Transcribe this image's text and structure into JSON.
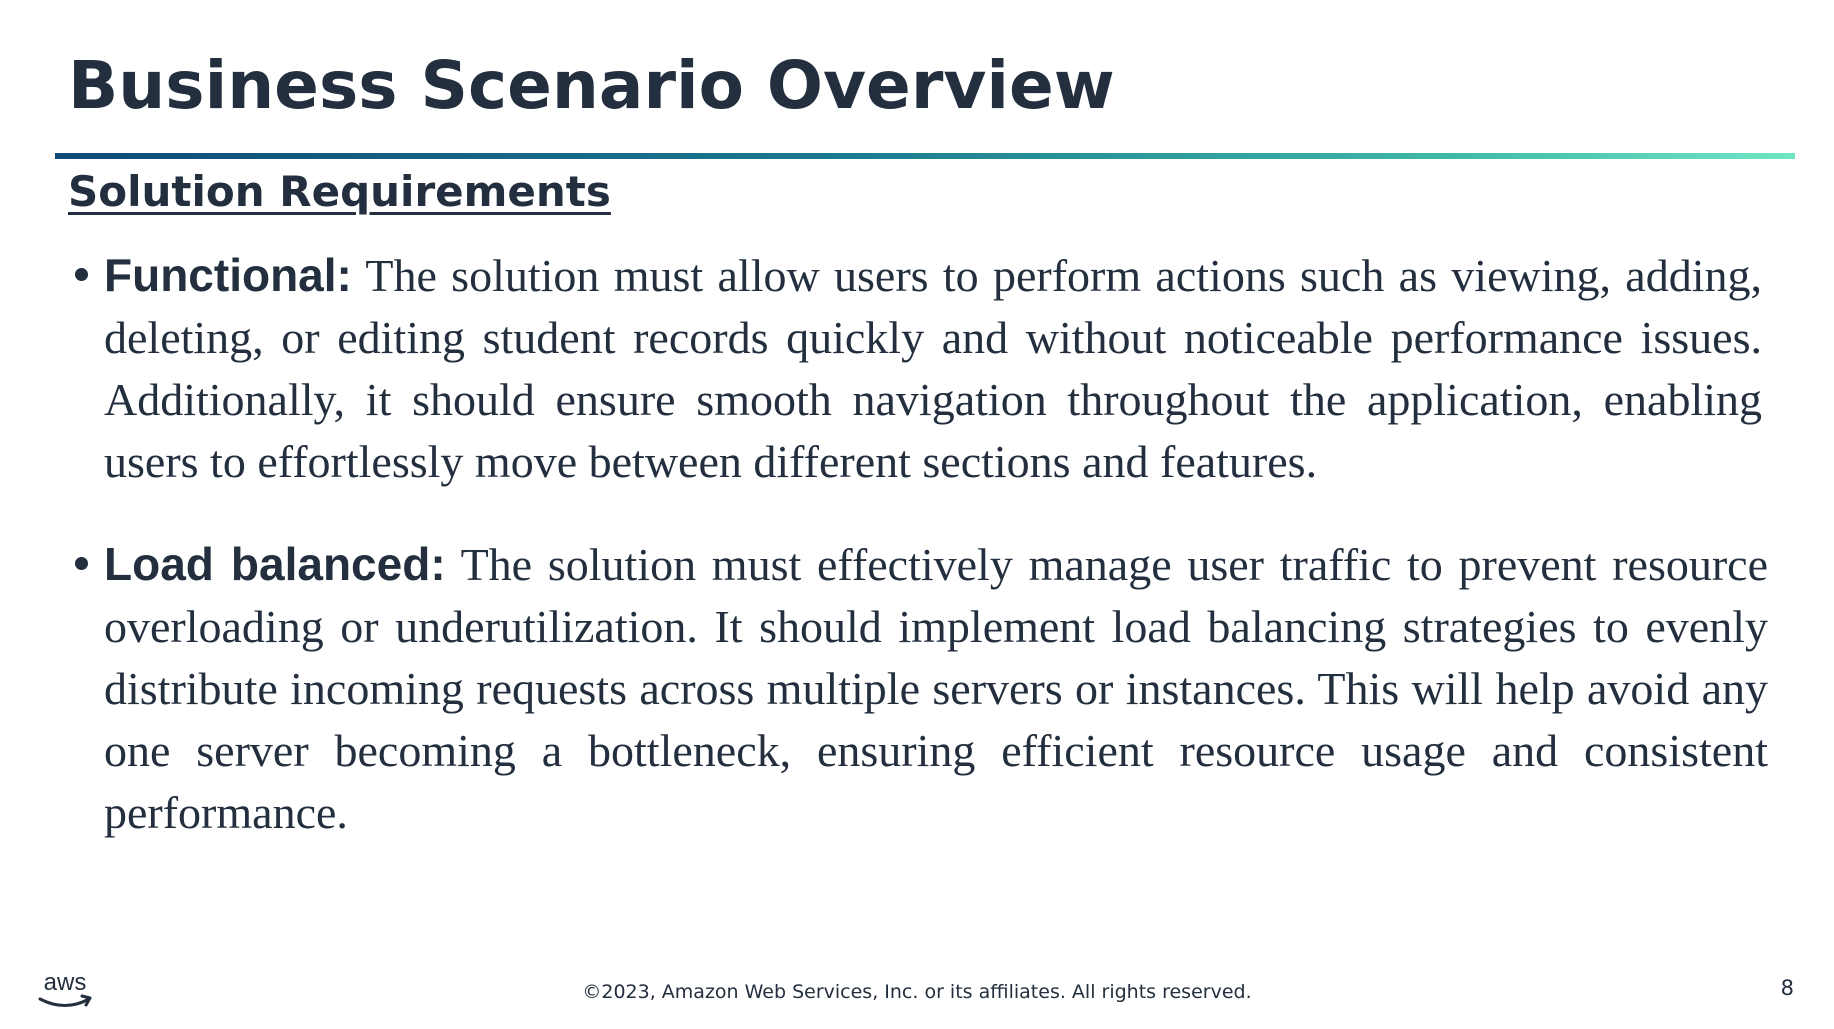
{
  "slide": {
    "title": "Business Scenario Overview",
    "section_heading": "Solution Requirements",
    "bullets": [
      {
        "label": "Functional:",
        "text": "The solution must allow users to perform actions such as viewing, adding, deleting, or editing student records quickly and without noticeable performance issues. Additionally, it should ensure smooth navigation throughout the application, enabling users to effortlessly move between different sections and features."
      },
      {
        "label": "Load balanced:",
        "text": "The solution must effectively manage user traffic to prevent resource overloading or underutilization. It should implement load balancing strategies to evenly distribute incoming requests across multiple servers or instances. This will help avoid any one server becoming a bottleneck, ensuring efficient resource usage and consistent performance."
      }
    ]
  },
  "footer": {
    "logo_icon": "aws-logo-icon",
    "logo_text": "aws",
    "copyright": "©2023, Amazon Web Services, Inc. or its affiliates. All rights reserved.",
    "page_number": "8"
  },
  "colors": {
    "text": "#232f3e",
    "rule_start": "#0f4a78",
    "rule_end": "#6ee6c4"
  }
}
